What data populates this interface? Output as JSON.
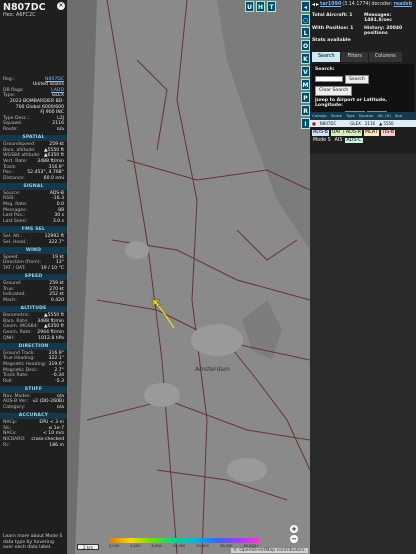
{
  "aircraft": {
    "callsign": "N807DC",
    "hex_label": "Hex:",
    "hex": "A6FC2C",
    "reg_label": "Reg.:",
    "reg": "N807DC",
    "country": "United States",
    "dbflags_label": "DB flags:",
    "dbflags": "LADD",
    "type_label": "Type:",
    "type": "GLEX",
    "desc_year": "2023 BOMBARDIER BD-",
    "desc_model": "700 Global 6000/600",
    "desc_line3": "FJ 900 INC",
    "typedesc_label": "Type Desc.:",
    "typedesc": "L2J",
    "squawk_label": "Squawk:",
    "squawk": "2116",
    "route_label": "Route:",
    "route": "n/a"
  },
  "sections": {
    "spatial": "SPATIAL",
    "signal": "SIGNAL",
    "fms": "FMS SEL",
    "wind": "WIND",
    "speed": "SPEED",
    "altitude": "ALTITUDE",
    "direction": "DIRECTION",
    "stuff": "STUFF",
    "accuracy": "ACCURACY"
  },
  "spatial": [
    {
      "k": "Groundspeed:",
      "v": "259 kt"
    },
    {
      "k": "Baro. altitude:",
      "v": "▲5550 ft"
    },
    {
      "k": "WGS84 altitude:",
      "v": "▲6350 ft"
    },
    {
      "k": "Vert. Rate:",
      "v": "3488 ft/min"
    },
    {
      "k": "Track:",
      "v": "316.9°"
    },
    {
      "k": "Pos.:",
      "v": "52.453°, 4.768°"
    },
    {
      "k": "Distance:",
      "v": "60.0 nmi"
    }
  ],
  "signal": [
    {
      "k": "Source:",
      "v": "ADS-B"
    },
    {
      "k": "RSSI:",
      "v": "-16.3"
    },
    {
      "k": "Msg. Rate:",
      "v": "0.0"
    },
    {
      "k": "Messages:",
      "v": "88"
    },
    {
      "k": "Last Pos.:",
      "v": "30 s"
    },
    {
      "k": "Last Seen:",
      "v": "3.0 s"
    }
  ],
  "fms": [
    {
      "k": "Sel. Alt.:",
      "v": "12992 ft"
    },
    {
      "k": "Sel. Head.:",
      "v": "322.7°"
    }
  ],
  "wind": [
    {
      "k": "Speed:",
      "v": "19 kt"
    },
    {
      "k": "Direction (from):",
      "v": "13°"
    },
    {
      "k": "TAT / OAT:",
      "v": "19 / 10 °C"
    }
  ],
  "speed": [
    {
      "k": "Ground:",
      "v": "259 kt"
    },
    {
      "k": "True:",
      "v": "270 kt"
    },
    {
      "k": "Indicated:",
      "v": "252 kt"
    },
    {
      "k": "Mach:",
      "v": "0.420"
    }
  ],
  "altitude": [
    {
      "k": "Barometric:",
      "v": "▲5550 ft"
    },
    {
      "k": "Baro. Rate:",
      "v": "3488 ft/min"
    },
    {
      "k": "Geom. WGS84:",
      "v": "▲6350 ft"
    },
    {
      "k": "Geom. Rate:",
      "v": "2944 ft/min"
    },
    {
      "k": "QNH:",
      "v": "1012.8 hPa"
    }
  ],
  "direction": [
    {
      "k": "Ground Track:",
      "v": "316.9°"
    },
    {
      "k": "True Heading:",
      "v": "322.1°"
    },
    {
      "k": "Magnetic Heading:",
      "v": "319.6°"
    },
    {
      "k": "Magnetic Decl.:",
      "v": "2.7°"
    },
    {
      "k": "Track Rate:",
      "v": "-0.34"
    },
    {
      "k": "Roll:",
      "v": "-5.3"
    }
  ],
  "stuff": [
    {
      "k": "Nav. Modes:",
      "v": "n/a"
    },
    {
      "k": "ADS-B Ver.:",
      "v": "v2 (DO-260B)"
    },
    {
      "k": "Category:",
      "v": "n/a"
    }
  ],
  "accuracy": [
    {
      "k": "NACp:",
      "v": "EPU < 3 m"
    },
    {
      "k": "SIL:",
      "v": "≤ 1e-7"
    },
    {
      "k": "NACv:",
      "v": "< 10 m/s"
    },
    {
      "k": "NICBARO:",
      "v": "cross-checked"
    },
    {
      "k": "Rc:",
      "v": "186 m"
    }
  ],
  "left_footer": "Learn more about Mode S data type by hovering over each data label.",
  "map": {
    "top_buttons": [
      "U",
      "H",
      "T"
    ],
    "side_buttons": [
      "◂",
      "○",
      "L",
      "O",
      "K",
      "V",
      "M",
      "P",
      "R",
      "I"
    ],
    "zoom_in": "+",
    "zoom_out": "−",
    "scale": "2 km",
    "colorbar_labels": [
      "2,000",
      "4,000",
      "8,000",
      "10,000",
      "20,000",
      "30,000",
      "40,000+"
    ],
    "city_label": "Amsterdam",
    "attribution": "© OpenStreetMap contributors."
  },
  "right": {
    "nav_prev": "◂",
    "nav_next": "▸",
    "version_link": "tar1090",
    "version": "(3.14.1774)",
    "decoder_label": "decoder:",
    "decoder_link": "readsb",
    "stats": [
      {
        "k": "Total Aircraft:",
        "v": "1"
      },
      {
        "k": "Messages:",
        "v": "1491.8/sec"
      },
      {
        "k": "With Position:",
        "v": "1"
      },
      {
        "k": "History:",
        "v": "20040 positions"
      }
    ],
    "stats_available": "Stats available",
    "tabs": [
      "Search",
      "Filters",
      "Columns"
    ],
    "search_label": "Search:",
    "search_button": "Search",
    "clear_search": "Clear Search",
    "jump_label": "Jump to Airport or Latitude, Longitude:",
    "jump_button": "Jump",
    "clear_button": "Clear",
    "table_headers": [
      "Callsign",
      "Route",
      "Type",
      "Squawk",
      "Alt. (ft)",
      "Spd"
    ],
    "table_row": {
      "flag": "■",
      "callsign": "N807DC",
      "type": "GLEX",
      "squawk": "2116",
      "alt": "▲ 5550"
    },
    "legend": [
      {
        "label": "ADS-B",
        "color": "#cfe3ff"
      },
      {
        "label": "UAT / ADS-R",
        "color": "#d7f0c0"
      },
      {
        "label": "MLAT",
        "color": "#ffe8c0"
      },
      {
        "label": "TIS-B",
        "color": "#ffcaca"
      },
      {
        "label": "Mode S",
        "color": ""
      },
      {
        "label": "AIS",
        "color": ""
      },
      {
        "label": "ADS-C",
        "color": "#c8f5d8"
      }
    ]
  }
}
